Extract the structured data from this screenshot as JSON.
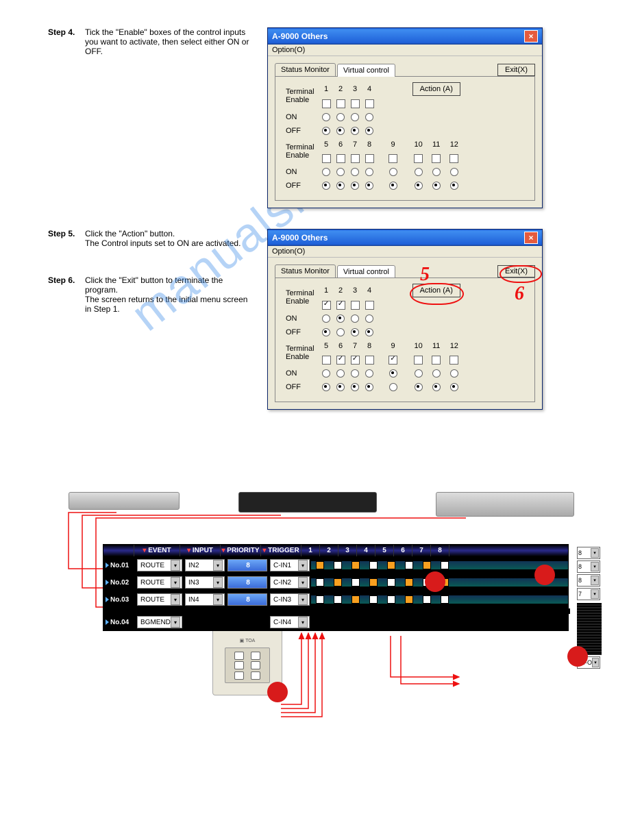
{
  "steps": {
    "s4": {
      "label": "Step 4.",
      "text": "Tick the \"Enable\" boxes of the control inputs you want to activate, then select either ON or OFF."
    },
    "s5": {
      "label": "Step 5.",
      "text1": "Click the \"Action\" button.",
      "text2": "The Control inputs set to ON are activated."
    },
    "s6": {
      "label": "Step 6.",
      "text1": "Click the \"Exit\" button to terminate the program.",
      "text2": "The screen returns to the initial menu screen in Step 1."
    }
  },
  "watermark": "manualshive.com",
  "dialog": {
    "title": "A-9000 Others",
    "menu": "Option(O)",
    "tab1": "Status Monitor",
    "tab2": "Virtual control",
    "exit": "Exit(X)",
    "action": "Action (A)",
    "row_terminal": "Terminal",
    "row_enable": "Enable",
    "row_on": "ON",
    "row_off": "OFF",
    "nums_a": [
      "1",
      "2",
      "3",
      "4"
    ],
    "nums_b": [
      "5",
      "6",
      "7",
      "8",
      "9",
      "10",
      "11",
      "12"
    ]
  },
  "callouts": {
    "c5": "5",
    "c6": "6"
  },
  "matrix": {
    "headers": {
      "event": "EVENT",
      "input": "INPUT",
      "priority": "PRIORITY",
      "trigger": "TRIGGER"
    },
    "ch_nums": [
      "1",
      "2",
      "3",
      "4",
      "5",
      "6",
      "7",
      "8"
    ],
    "rows": [
      {
        "id": "No.01",
        "event": "ROUTE",
        "input": "IN2",
        "priority": "8",
        "trigger": "C-IN1"
      },
      {
        "id": "No.02",
        "event": "ROUTE",
        "input": "IN3",
        "priority": "8",
        "trigger": "C-IN2"
      },
      {
        "id": "No.03",
        "event": "ROUTE",
        "input": "IN4",
        "priority": "8",
        "trigger": "C-IN3"
      },
      {
        "id": "No.04",
        "event": "BGMEND",
        "input": "",
        "priority": "",
        "trigger": "C-IN4"
      }
    ],
    "side": [
      "8",
      "8",
      "8",
      "7"
    ],
    "queue": "LIFO"
  }
}
